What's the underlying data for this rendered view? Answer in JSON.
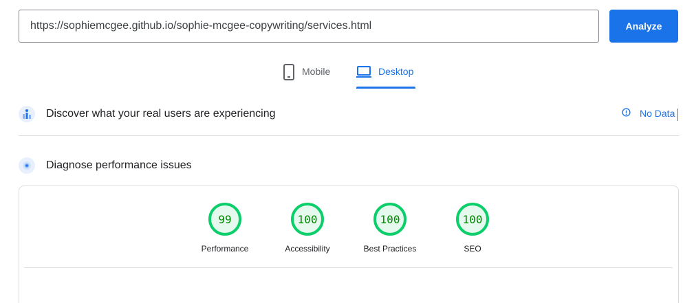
{
  "search": {
    "url_value": "https://sophiemcgee.github.io/sophie-mcgee-copywriting/services.html",
    "analyze_label": "Analyze"
  },
  "tabs": {
    "mobile_label": "Mobile",
    "desktop_label": "Desktop",
    "selected": "Desktop"
  },
  "field_data": {
    "title": "Discover what your real users are experiencing",
    "status_label": "No Data",
    "status_icon": "info-icon"
  },
  "lab_data": {
    "title": "Diagnose performance issues",
    "scores": [
      {
        "label": "Performance",
        "value": "99",
        "score": 99
      },
      {
        "label": "Accessibility",
        "value": "100",
        "score": 100
      },
      {
        "label": "Best Practices",
        "value": "100",
        "score": 100
      },
      {
        "label": "SEO",
        "value": "100",
        "score": 100
      }
    ]
  },
  "colors": {
    "accent": "#1a73e8",
    "good": "#0cce6b",
    "good_text": "#008800"
  }
}
